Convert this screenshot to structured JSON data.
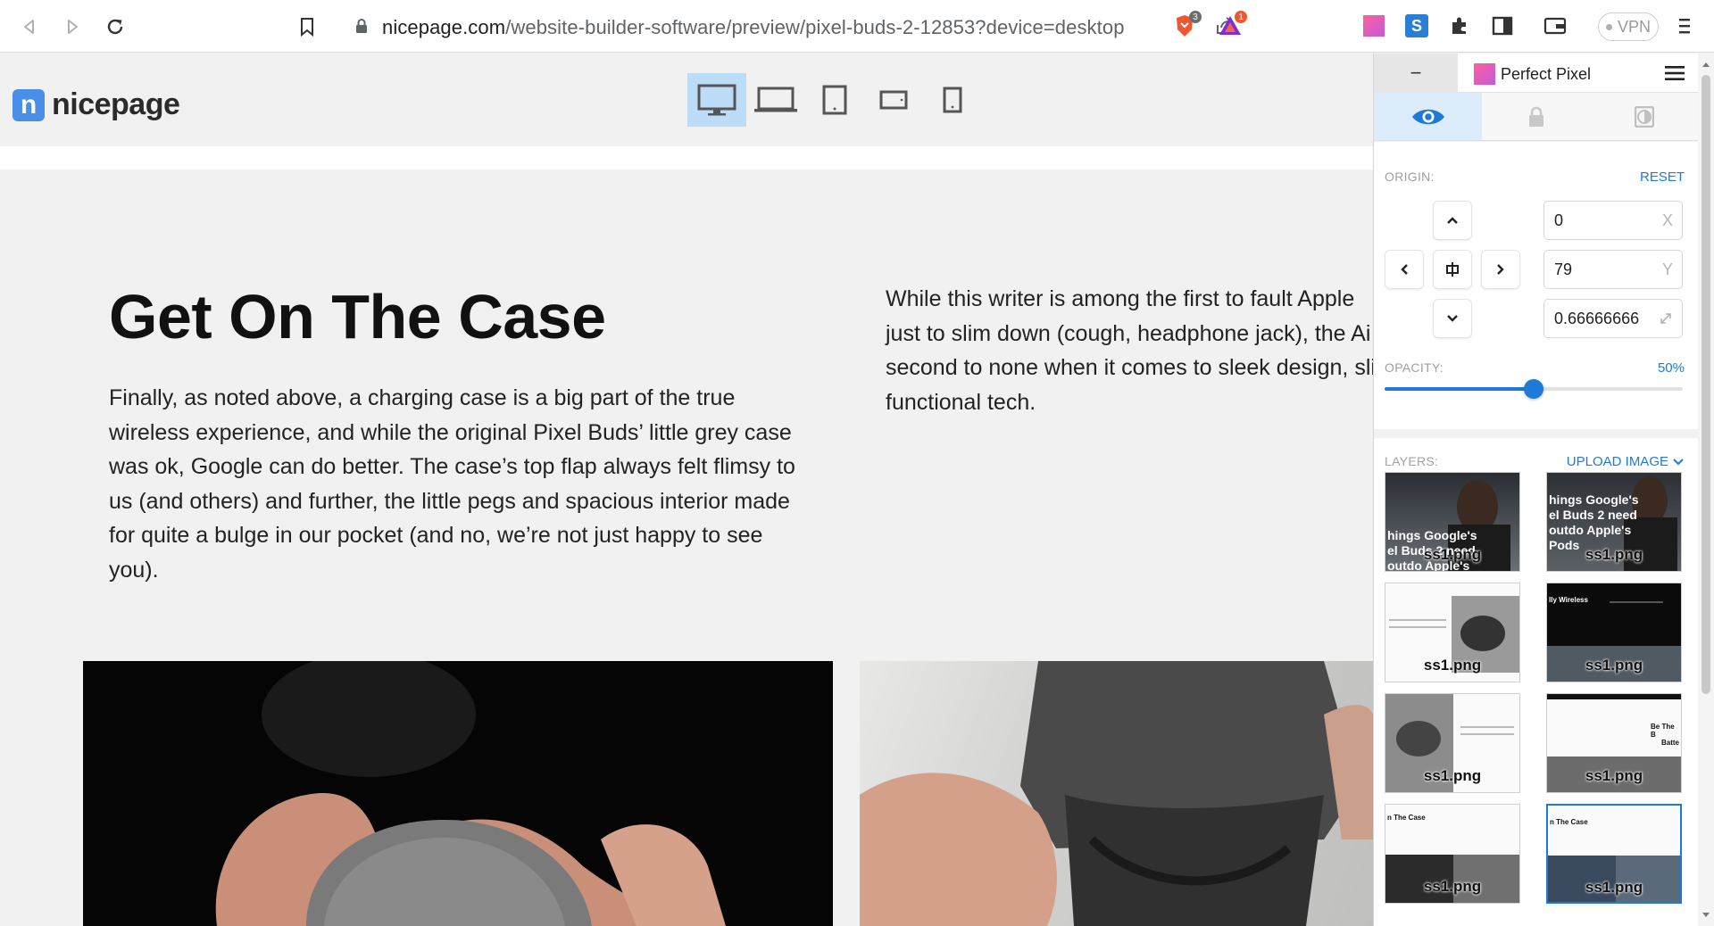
{
  "browser": {
    "url_host": "nicepage.com",
    "url_path": "/website-builder-software/preview/pixel-buds-2-12853?device=desktop",
    "brave_badge": "3",
    "rewards_badge": "1",
    "vpn_label": "VPN"
  },
  "site": {
    "logo_text": "nicepage",
    "logo_mark": "n",
    "devices": [
      "desktop",
      "laptop",
      "tablet",
      "tablet-landscape",
      "phone"
    ],
    "active_device": "desktop"
  },
  "article": {
    "heading": "Get On The Case",
    "left_lines": [
      "Finally, as noted above, a charging case is a big part of the true",
      "wireless experience, and while the original Pixel Buds’ little grey case",
      "was ok, Google can do better. The case’s top flap always felt flimsy to",
      "us (and others) and further, the little pegs and spacious interior made",
      "for quite a bulge in our pocket (and no, we’re not just happy to see",
      "you)."
    ],
    "right_lines": [
      "While this writer is among the first to fault Apple",
      "just to slim down (cough, headphone jack), the Ai",
      "second to none when it comes to sleek design, sli",
      "functional tech."
    ]
  },
  "perfect_pixel": {
    "minimize_label": "−",
    "brand": "Perfect Pixel",
    "origin_label": "ORIGIN:",
    "reset_label": "RESET",
    "x_value": "0",
    "x_suffix": "X",
    "y_value": "79",
    "y_suffix": "Y",
    "scale_value": "0.66666666",
    "opacity_label": "OPACITY:",
    "opacity_value": "50%",
    "opacity_fraction": 0.5,
    "layers_label": "LAYERS:",
    "upload_label": "UPLOAD IMAGE",
    "layers": [
      {
        "name": "ss1.png",
        "overlay": [
          "hings Google's",
          "el Buds 2 need",
          "outdo Apple's"
        ]
      },
      {
        "name": "ss1.png",
        "overlay": [
          "hings Google's",
          "el Buds 2 need",
          "outdo Apple's",
          "Pods"
        ]
      },
      {
        "name": "ss1.png",
        "overlay": []
      },
      {
        "name": "ss1.png",
        "overlay": [
          "lly Wireless"
        ]
      },
      {
        "name": "ss1.png",
        "overlay": []
      },
      {
        "name": "ss1.png",
        "overlay": [
          "Be The B",
          "Batte"
        ]
      },
      {
        "name": "ss1.png",
        "overlay": [
          "n The Case"
        ]
      },
      {
        "name": "ss1.png",
        "overlay": [
          "n The Case"
        ]
      }
    ]
  }
}
